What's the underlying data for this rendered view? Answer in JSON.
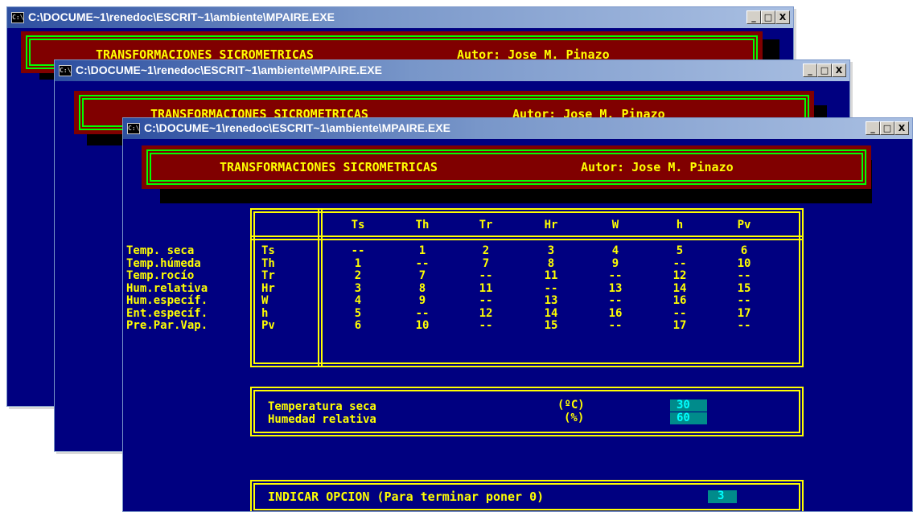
{
  "window_title": "C:\\DOCUME~1\\renedoc\\ESCRIT~1\\ambiente\\MPAIRE.EXE",
  "console_icon": "cmd-icon",
  "window_controls": [
    "_",
    "□",
    "X"
  ],
  "header": {
    "title": "TRANSFORMACIONES SICROMETRICAS",
    "author": "Autor: Jose M. Pinazo"
  },
  "table": {
    "columns": [
      "Ts",
      "Th",
      "Tr",
      "Hr",
      "W",
      "h",
      "Pv"
    ],
    "rows": [
      {
        "name": "Temp. seca",
        "code": "Ts",
        "cells": [
          "--",
          "1",
          "2",
          "3",
          "4",
          "5",
          "6"
        ]
      },
      {
        "name": "Temp.húmeda",
        "code": "Th",
        "cells": [
          "1",
          "--",
          "7",
          "8",
          "9",
          "--",
          "10"
        ]
      },
      {
        "name": "Temp.rocío",
        "code": "Tr",
        "cells": [
          "2",
          "7",
          "--",
          "11",
          "--",
          "12",
          "--"
        ]
      },
      {
        "name": "Hum.relativa",
        "code": "Hr",
        "cells": [
          "3",
          "8",
          "11",
          "--",
          "13",
          "14",
          "15"
        ]
      },
      {
        "name": "Hum.específ.",
        "code": "W",
        "cells": [
          "4",
          "9",
          "--",
          "13",
          "--",
          "16",
          "--"
        ]
      },
      {
        "name": "Ent.específ.",
        "code": "h",
        "cells": [
          "5",
          "--",
          "12",
          "14",
          "16",
          "--",
          "17"
        ]
      },
      {
        "name": "Pre.Par.Vap.",
        "code": "Pv",
        "cells": [
          "6",
          "10",
          "--",
          "15",
          "--",
          "17",
          "--"
        ]
      }
    ]
  },
  "inputs": {
    "temp_label": "Temperatura seca",
    "temp_unit": "(ºC)",
    "temp_value": "30",
    "hum_label": "Humedad relativa",
    "hum_unit": "(%)",
    "hum_value": "60"
  },
  "prompt": {
    "label": "INDICAR OPCION (Para terminar poner 0)",
    "value": "3"
  },
  "colors": {
    "console_bg": "#000080",
    "text": "#ffff00",
    "header_bg": "#800000",
    "header_border": "#00ff00",
    "input_bg": "#008b8b",
    "input_text": "#00ffff"
  }
}
